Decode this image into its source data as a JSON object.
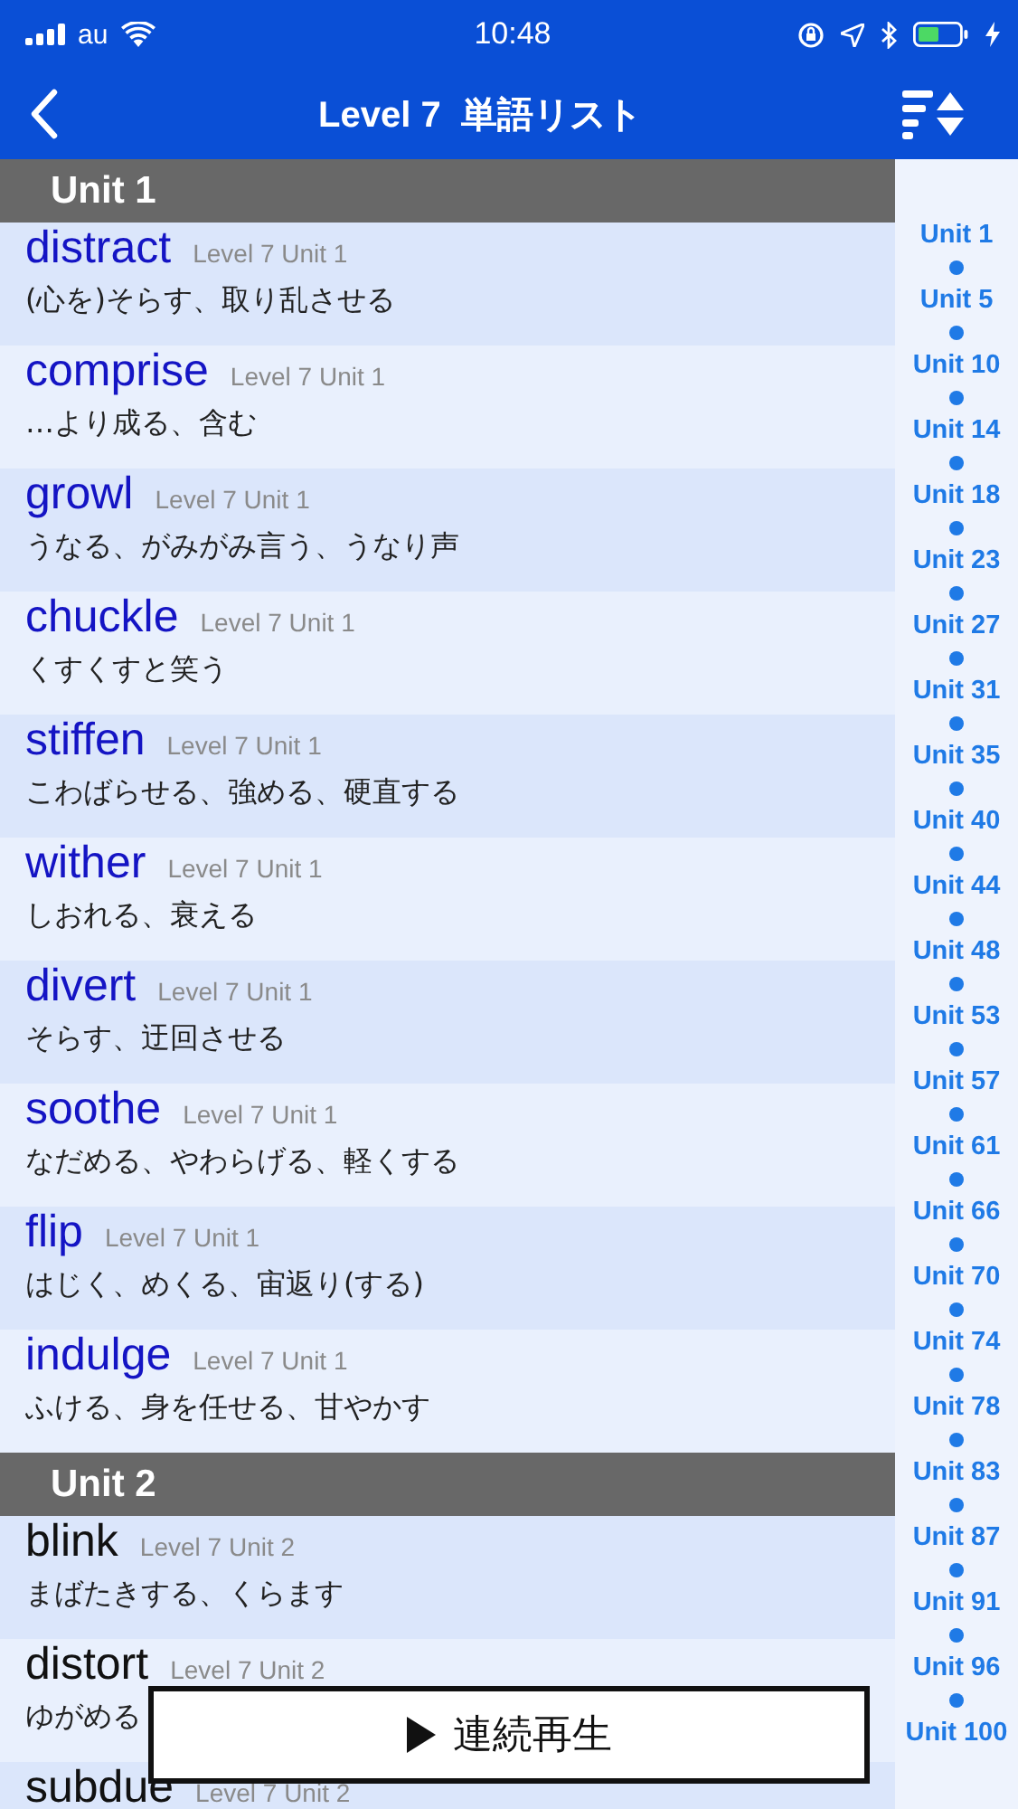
{
  "status_bar": {
    "carrier": "au",
    "time": "10:48"
  },
  "nav": {
    "title": "Level 7  単語リスト"
  },
  "sections": [
    {
      "title": "Unit 1",
      "words": [
        {
          "word": "distract",
          "level": "Level 7 Unit 1",
          "meaning": "(心を)そらす、取り乱させる",
          "highlighted": true
        },
        {
          "word": "comprise",
          "level": "Level 7 Unit 1",
          "meaning": "…より成る、含む",
          "highlighted": true
        },
        {
          "word": "growl",
          "level": "Level 7 Unit 1",
          "meaning": "うなる、がみがみ言う、うなり声",
          "highlighted": true
        },
        {
          "word": "chuckle",
          "level": "Level 7 Unit 1",
          "meaning": "くすくすと笑う",
          "highlighted": true
        },
        {
          "word": "stiffen",
          "level": "Level 7 Unit 1",
          "meaning": "こわばらせる、強める、硬直する",
          "highlighted": true
        },
        {
          "word": "wither",
          "level": "Level 7 Unit 1",
          "meaning": "しおれる、衰える",
          "highlighted": true
        },
        {
          "word": "divert",
          "level": "Level 7 Unit 1",
          "meaning": "そらす、迂回させる",
          "highlighted": true
        },
        {
          "word": "soothe",
          "level": "Level 7 Unit 1",
          "meaning": "なだめる、やわらげる、軽くする",
          "highlighted": true
        },
        {
          "word": "flip",
          "level": "Level 7 Unit 1",
          "meaning": "はじく、めくる、宙返り(する)",
          "highlighted": true
        },
        {
          "word": "indulge",
          "level": "Level 7 Unit 1",
          "meaning": "ふける、身を任せる、甘やかす",
          "highlighted": true
        }
      ]
    },
    {
      "title": "Unit 2",
      "words": [
        {
          "word": "blink",
          "level": "Level 7 Unit 2",
          "meaning": "まばたきする、くらます",
          "highlighted": false
        },
        {
          "word": "distort",
          "level": "Level 7 Unit 2",
          "meaning": "ゆがめる",
          "highlighted": false
        },
        {
          "word": "subdue",
          "level": "Level 7 Unit 2",
          "highlighted": false
        }
      ]
    }
  ],
  "index": [
    "Unit 1",
    "Unit 5",
    "Unit 10",
    "Unit 14",
    "Unit 18",
    "Unit 23",
    "Unit 27",
    "Unit 31",
    "Unit 35",
    "Unit 40",
    "Unit 44",
    "Unit 48",
    "Unit 53",
    "Unit 57",
    "Unit 61",
    "Unit 66",
    "Unit 70",
    "Unit 74",
    "Unit 78",
    "Unit 83",
    "Unit 87",
    "Unit 91",
    "Unit 96",
    "Unit 100"
  ],
  "play_button": {
    "label": "連続再生"
  }
}
